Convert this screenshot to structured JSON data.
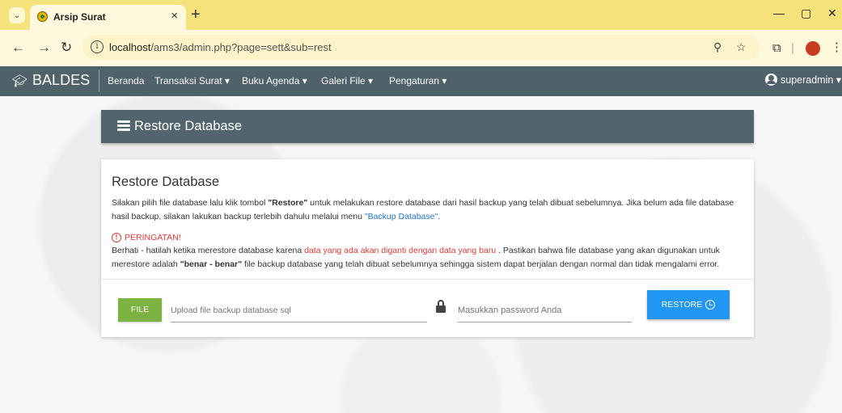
{
  "browser": {
    "tab_title": "Arsip Surat",
    "tab_close": "×",
    "new_tab": "+",
    "url_host": "localhost",
    "url_path": "/ams3/admin.php?page=sett&sub=rest"
  },
  "navbar": {
    "brand": "BALDES",
    "menu": [
      {
        "label": "Beranda"
      },
      {
        "label": "Transaksi Surat ▾"
      },
      {
        "label": "Buku Agenda ▾"
      },
      {
        "label": "Galeri File ▾"
      },
      {
        "label": "Pengaturan ▾"
      }
    ],
    "user": "superadmin ▾"
  },
  "page_header": {
    "title": "Restore Database"
  },
  "card": {
    "heading": "Restore Database",
    "desc_part1": "Silakan pilih file database lalu klik tombol ",
    "desc_restore": "\"Restore\"",
    "desc_part2": " untuk melakukan restore database dari hasil backup yang telah dibuat sebelumnya. Jika belum ada file database hasil backup, silakan lakukan backup terlebih dahulu melalui menu ",
    "desc_link": "\"Backup Database\"",
    "desc_end": ".",
    "warning_title": "PERINGATAN!",
    "warn_part1": "Berhati - hatilah ketika merestore database karena ",
    "warn_red": " data yang ada akan diganti dengan data yang baru ",
    "warn_part2": ". Pastikan bahwa file database yang akan digunakan untuk merestore adalah ",
    "warn_bold": "\"benar - benar\"",
    "warn_part3": " file backup database yang telah dibuat sebelumnya sehingga sistem dapat berjalan dengan normal dan tidak mengalami error."
  },
  "form": {
    "file_button": "FILE",
    "file_placeholder": "Upload file backup database sql",
    "password_placeholder": "Masukkan password Anda",
    "restore_button": "RESTORE"
  },
  "colors": {
    "navbar": "#4f6169",
    "file_button": "#7cb342",
    "restore_button": "#2196f3",
    "warning": "#e53935"
  }
}
